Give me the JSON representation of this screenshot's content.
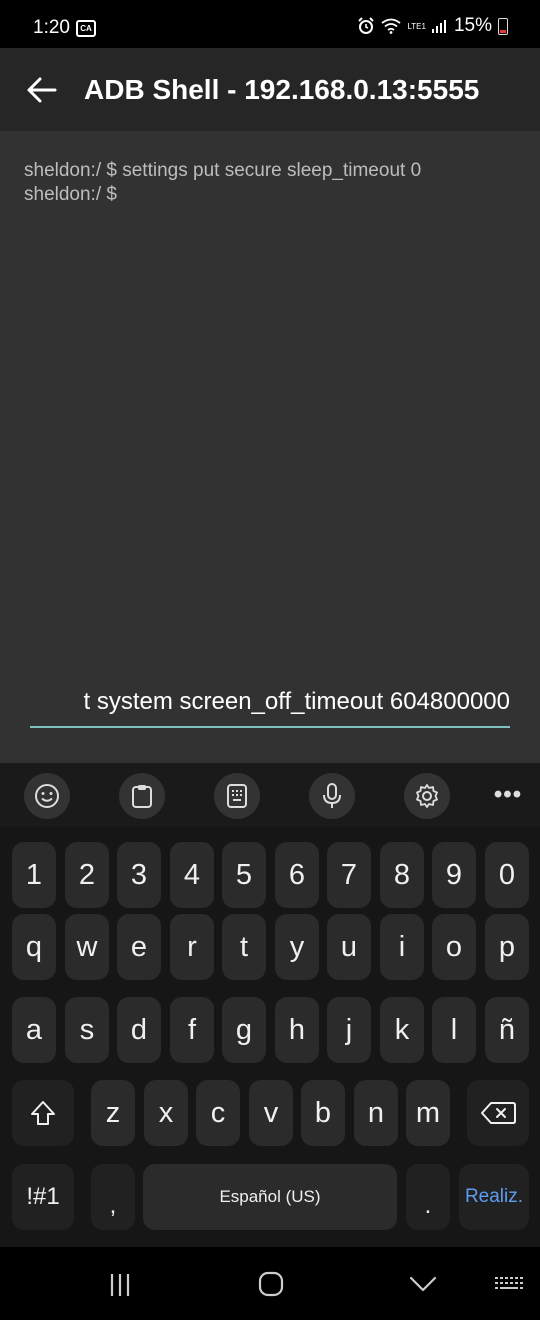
{
  "status_bar": {
    "time": "1:20",
    "notification_icon": "ca-icon",
    "notification_text": "CA",
    "lte_label": "LTE1",
    "battery": "15%"
  },
  "app_bar": {
    "title": "ADB Shell - 192.168.0.13:5555"
  },
  "terminal": {
    "lines": [
      "sheldon:/ $ settings put secure sleep_timeout 0",
      "sheldon:/ $"
    ],
    "input_value": "t system screen_off_timeout 604800000",
    "accent_color": "#7fc1c1"
  },
  "keyboard": {
    "toolbar": [
      "emoji-icon",
      "clipboard-icon",
      "keyboard-mode-icon",
      "microphone-icon",
      "settings-icon",
      "more-icon"
    ],
    "more_label": "•••",
    "row_numbers": [
      "1",
      "2",
      "3",
      "4",
      "5",
      "6",
      "7",
      "8",
      "9",
      "0"
    ],
    "row_top": [
      "q",
      "w",
      "e",
      "r",
      "t",
      "y",
      "u",
      "i",
      "o",
      "p"
    ],
    "row_mid": [
      "a",
      "s",
      "d",
      "f",
      "g",
      "h",
      "j",
      "k",
      "l",
      "ñ"
    ],
    "row_bottom": [
      "z",
      "x",
      "c",
      "v",
      "b",
      "n",
      "m"
    ],
    "symbols_label": "!#1",
    "comma_label": ",",
    "space_label": "Español (US)",
    "period_label": ".",
    "enter_label": "Realiz.",
    "enter_color": "#5e9cf0"
  },
  "nav_bar": [
    "recents-icon",
    "home-icon",
    "back-chevron-icon",
    "keyboard-switch-icon"
  ]
}
